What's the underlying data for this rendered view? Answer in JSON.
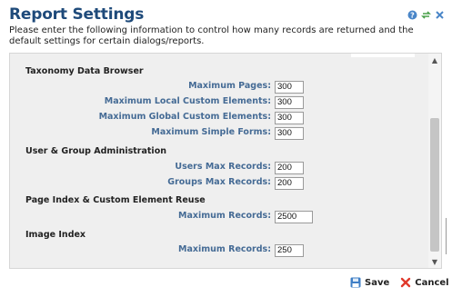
{
  "header": {
    "title": "Report Settings",
    "description": "Please enter the following information to control how many records are returned and the default settings for certain dialogs/reports.",
    "icons": [
      "help-icon",
      "refresh-icon",
      "close-icon"
    ]
  },
  "sections": {
    "taxonomy": {
      "title": "Taxonomy Data Browser",
      "fields": {
        "max_pages": {
          "label": "Maximum Pages:",
          "value": "300"
        },
        "max_local": {
          "label": "Maximum Local Custom Elements:",
          "value": "300"
        },
        "max_global": {
          "label": "Maximum Global Custom Elements:",
          "value": "300"
        },
        "max_simple": {
          "label": "Maximum Simple Forms:",
          "value": "300"
        }
      }
    },
    "user_group": {
      "title": "User & Group Administration",
      "fields": {
        "users_max": {
          "label": "Users Max Records:",
          "value": "200"
        },
        "groups_max": {
          "label": "Groups Max Records:",
          "value": "200"
        }
      }
    },
    "page_index": {
      "title": "Page Index & Custom Element Reuse",
      "fields": {
        "max_records": {
          "label": "Maximum Records:",
          "value": "2500"
        }
      }
    },
    "image_index": {
      "title": "Image Index",
      "fields": {
        "max_records": {
          "label": "Maximum Records:",
          "value": "250"
        }
      }
    }
  },
  "actions": {
    "save_label": "Save",
    "cancel_label": "Cancel"
  },
  "colors": {
    "title": "#1e4a7a",
    "label": "#456b95",
    "panel": "#efefef"
  }
}
